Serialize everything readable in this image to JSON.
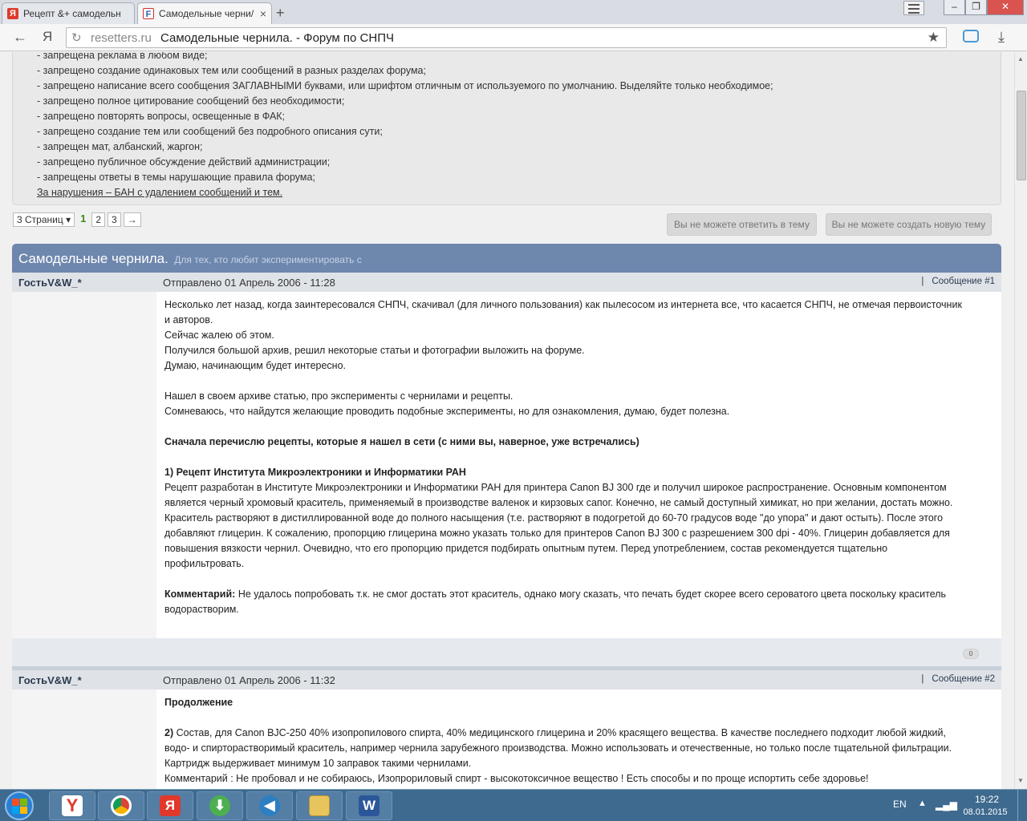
{
  "browser": {
    "tabs": [
      {
        "label": "Рецепт &+ самодельн",
        "favicon": "Я"
      },
      {
        "label": "Самодельные черни/",
        "favicon": "F"
      }
    ],
    "new_tab": "+",
    "address": {
      "domain": "resetters.ru",
      "title": "Самодельные чернила. - Форум по СНПЧ"
    },
    "nav": {
      "back": "←",
      "yandex": "Я",
      "reload": "↻",
      "star": "★",
      "download": "⤓"
    },
    "window": {
      "minimize": "–",
      "maximize": "❐",
      "close": "✕"
    }
  },
  "rules": {
    "lines": [
      "- запрещена реклама в любом виде;",
      "- запрещено создание одинаковых тем или сообщений в разных разделах форума;",
      "- запрещено написание всего сообщения ЗАГЛАВНЫМИ буквами, или шрифтом отличным от используемого по умолчанию. Выделяйте только необходимое;",
      "- запрещено полное цитирование сообщений без необходимости;",
      "- запрещено повторять вопросы, освещенные в ФАК;",
      "- запрещено создание тем или сообщений без подробного описания сути;",
      "- запрещен мат, албанский, жаргон;",
      "- запрещено публичное обсуждение действий администрации;",
      "- запрещены ответы в темы нарушающие правила форума;"
    ],
    "ban": "За нарушения – БАН с удалением сообщений и тем."
  },
  "pager": {
    "pages_label": "3 Страниц",
    "current": "1",
    "pages": [
      "2",
      "3"
    ],
    "next": "→"
  },
  "buttons": {
    "reply": "Вы не можете ответить в тему",
    "new_topic": "Вы не можете создать новую тему"
  },
  "topic": {
    "title": "Самодельные чернила.",
    "description": "Для тех, кто любит экспериментировать с"
  },
  "posts": [
    {
      "author": "ГостьV&W_*",
      "date": "Отправлено 01 Апрель 2006 - 11:28",
      "sep": "|",
      "number": "Сообщение #1",
      "lines": [
        "Несколько лет назад, когда заинтересовался СНПЧ, скачивал (для личного пользования) как пылесосом из интернета все, что касается СНПЧ, не отмечая первоисточник",
        "и авторов.",
        "Сейчас жалею об этом.",
        "Получился большой архив, решил некоторые статьи и фотографии выложить на форуме.",
        "Думаю, начинающим будет интересно.",
        "Нашел в своем архиве статью, про эксперименты с чернилами и рецепты.",
        "Сомневаюсь, что найдутся желающие проводить подобные эксперименты, но для ознакомления, думаю, будет полезна.",
        "Сначала перечислю рецепты, которые я нашел в сети (с ними вы, наверное, уже встречались)",
        "1) Рецепт Института Микроэлектроники и Информатики РАН",
        "Рецепт разработан в Институте Микроэлектроники и Информатики РАН для принтера Canon BJ 300 где и получил широкое распространение. Основным компонентом",
        "является черный хромовый краситель, применяемый в производстве валенок и кирзовых сапог. Конечно, не самый доступный химикат, но при желании, достать можно.",
        "Краситель растворяют в дистиллированной воде до полного насыщения (т.е. растворяют в подогретой до 60-70 градусов воде \"до упора\" и дают остыть). После этого",
        "добавляют глицерин. К сожалению, пропорцию глицерина можно указать только для принтеров Canon BJ 300 с разрешением 300 dpi - 40%. Глицерин добавляется для",
        "повышения вязкости чернил. Очевидно, что его пропорцию придется подбирать опытным путем. Перед употреблением, состав рекомендуется тщательно",
        "профильтровать.",
        "Комментарий:",
        " Не удалось попробовать т.к. не смог достать этот краситель, однако могу сказать, что печать будет скорее всего сероватого цвета поскольку краситель",
        "водорастворим."
      ],
      "reputation": "0"
    },
    {
      "author": "ГостьV&W_*",
      "date": "Отправлено 01 Апрель 2006 - 11:32",
      "sep": "|",
      "number": "Сообщение #2",
      "lines": [
        "Продолжение",
        "2)",
        " Состав, для Canon BJC-250 40% изопропилового спирта, 40% медицинского глицерина и 20% красящего вещества. В качестве последнего подходит любой жидкий,",
        "водо- и спирторастворимый краситель, например чернила зарубежного производства. Можно использовать и отечественные, но только после тщательной фильтрации.",
        "Картридж выдерживает минимум 10 заправок такими чернилами.",
        "Комментарий : Не пробовал и не собираюсь, Изопрориловый спирт - высокотоксичное вещество ! Есть способы и по проще испортить себе здоровье!"
      ]
    }
  ],
  "taskbar": {
    "lang": "EN",
    "time": "19:22",
    "date": "08.01.2015"
  },
  "colors": {
    "topic_bar": "#6e87ad",
    "pager_current": "#3d8a1f",
    "taskbar": "#3f6a8f"
  }
}
